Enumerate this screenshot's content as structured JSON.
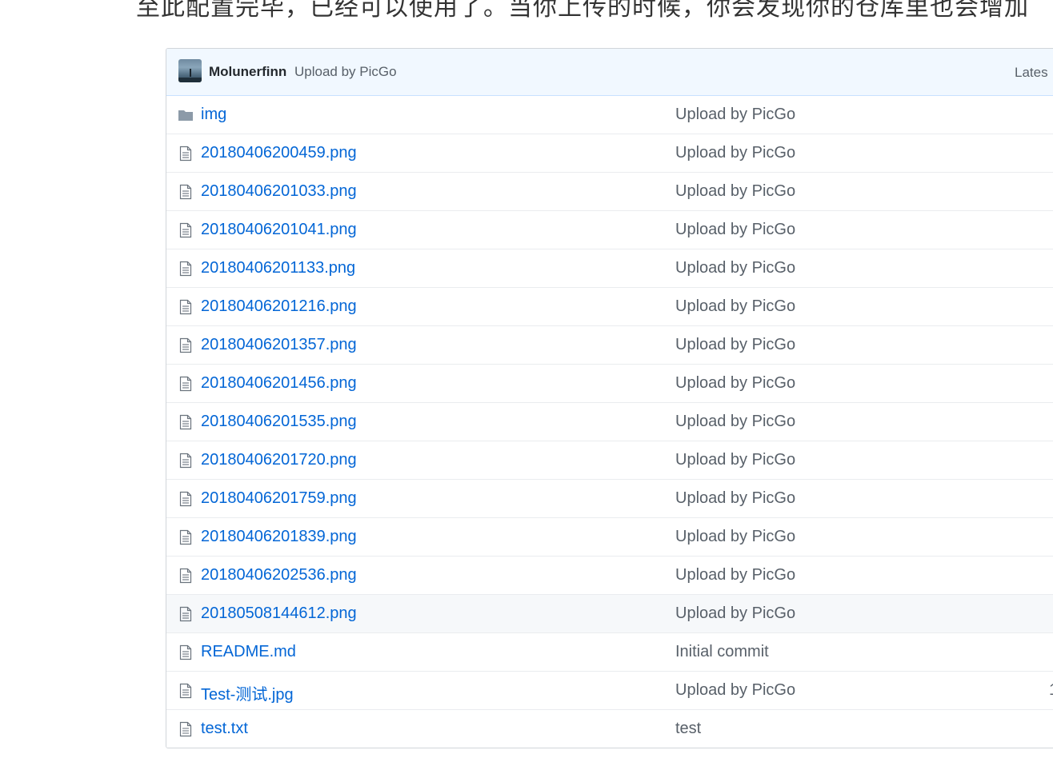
{
  "intro_text": "至此配置完毕，已经可以使用了。当你上传的时候，你会发现你的仓库里也会增加",
  "commit": {
    "author": "Molunerfinn",
    "message": "Upload by PicGo",
    "latest_label": "Lates"
  },
  "files": [
    {
      "type": "folder",
      "icon": "folder-icon",
      "name": "img",
      "message": "Upload by PicGo",
      "age": ""
    },
    {
      "type": "file",
      "icon": "file-icon",
      "name": "20180406200459.png",
      "message": "Upload by PicGo",
      "age": ""
    },
    {
      "type": "file",
      "icon": "file-icon",
      "name": "20180406201033.png",
      "message": "Upload by PicGo",
      "age": ""
    },
    {
      "type": "file",
      "icon": "file-icon",
      "name": "20180406201041.png",
      "message": "Upload by PicGo",
      "age": ""
    },
    {
      "type": "file",
      "icon": "file-icon",
      "name": "20180406201133.png",
      "message": "Upload by PicGo",
      "age": ""
    },
    {
      "type": "file",
      "icon": "file-icon",
      "name": "20180406201216.png",
      "message": "Upload by PicGo",
      "age": ""
    },
    {
      "type": "file",
      "icon": "file-icon",
      "name": "20180406201357.png",
      "message": "Upload by PicGo",
      "age": ""
    },
    {
      "type": "file",
      "icon": "file-icon",
      "name": "20180406201456.png",
      "message": "Upload by PicGo",
      "age": ""
    },
    {
      "type": "file",
      "icon": "file-icon",
      "name": "20180406201535.png",
      "message": "Upload by PicGo",
      "age": ""
    },
    {
      "type": "file",
      "icon": "file-icon",
      "name": "20180406201720.png",
      "message": "Upload by PicGo",
      "age": ""
    },
    {
      "type": "file",
      "icon": "file-icon",
      "name": "20180406201759.png",
      "message": "Upload by PicGo",
      "age": ""
    },
    {
      "type": "file",
      "icon": "file-icon",
      "name": "20180406201839.png",
      "message": "Upload by PicGo",
      "age": ""
    },
    {
      "type": "file",
      "icon": "file-icon",
      "name": "20180406202536.png",
      "message": "Upload by PicGo",
      "age": ""
    },
    {
      "type": "file",
      "icon": "file-icon",
      "name": "20180508144612.png",
      "message": "Upload by PicGo",
      "age": "",
      "hover": true
    },
    {
      "type": "file",
      "icon": "file-icon",
      "name": "README.md",
      "message": "Initial commit",
      "age": ""
    },
    {
      "type": "file",
      "icon": "file-icon",
      "name": "Test-测试.jpg",
      "message": "Upload by PicGo",
      "age": "1"
    },
    {
      "type": "file",
      "icon": "file-icon",
      "name": "test.txt",
      "message": "test",
      "age": ""
    }
  ],
  "colors": {
    "link": "#0366d6",
    "muted": "#586069",
    "header_bg": "#f1f8ff",
    "row_hover": "#f6f8fa",
    "folder": "#79b8ff"
  }
}
